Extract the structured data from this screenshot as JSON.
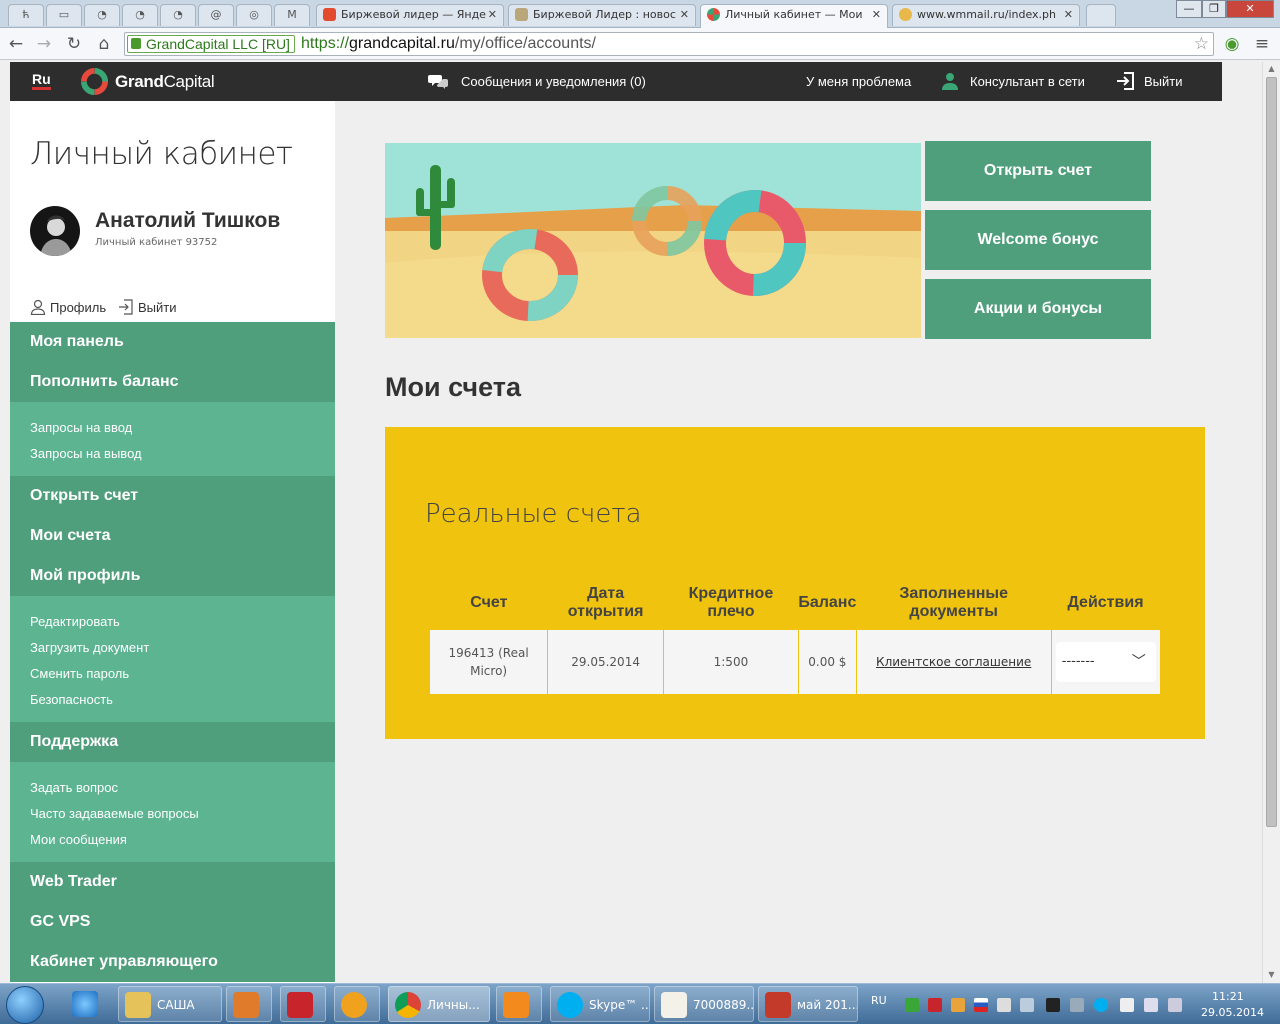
{
  "browser": {
    "tabs": [
      {
        "title": "Биржевой лидер — Янде"
      },
      {
        "title": "Биржевой Лидер : новос"
      },
      {
        "title": "Личный кабинет — Мои"
      },
      {
        "title": "www.wmmail.ru/index.ph"
      }
    ],
    "ev_label": "GrandCapital LLC [RU]",
    "url_scheme": "https://",
    "url_host": "grandcapital.ru",
    "url_path": "/my/office/accounts/"
  },
  "header": {
    "lang": "Ru",
    "logo_bold": "Grand",
    "logo_light": "Capital",
    "messages": "Сообщения и уведомления (0)",
    "problem": "У меня проблема",
    "consultant": "Консультант в сети",
    "logout": "Выйти"
  },
  "sidebar": {
    "title": "Личный кабинет",
    "user_name": "Анатолий Тишков",
    "user_sub": "Личный кабинет 93752",
    "profile_link": "Профиль",
    "logout_link": "Выйти",
    "menu": {
      "my_panel": "Моя панель",
      "deposit": "Пополнить баланс",
      "deposit_requests": "Запросы на ввод",
      "withdraw_requests": "Запросы на вывод",
      "open_account": "Открыть счет",
      "my_accounts": "Мои счета",
      "my_profile": "Мой профиль",
      "edit": "Редактировать",
      "upload_doc": "Загрузить документ",
      "change_password": "Сменить пароль",
      "security": "Безопасность",
      "support": "Поддержка",
      "ask_question": "Задать вопрос",
      "faq": "Часто задаваемые вопросы",
      "my_messages": "Мои сообщения",
      "web_trader": "Web Trader",
      "gc_vps": "GC VPS",
      "manager_cabinet": "Кабинет управляющего"
    }
  },
  "promo": {
    "open_account": "Открыть счет",
    "welcome_bonus": "Welcome бонус",
    "promotions": "Акции и бонусы"
  },
  "accounts": {
    "title": "Мои счета",
    "section_title": "Реальные счета",
    "columns": {
      "account": "Счет",
      "opened_1": "Дата",
      "opened_2": "открытия",
      "leverage_1": "Кредитное",
      "leverage_2": "плечо",
      "balance": "Баланс",
      "docs_1": "Заполненные",
      "docs_2": "документы",
      "actions": "Действия"
    },
    "row": {
      "account_1": "196413 (Real",
      "account_2": "Micro)",
      "opened": "29.05.2014",
      "leverage": "1:500",
      "balance": "0.00 $",
      "document": "Клиентское соглашение",
      "action_value": "-------"
    }
  },
  "taskbar": {
    "sasha": "САША",
    "chrome": "Личны...",
    "skype": "Skype™ ...",
    "alpari": "7000889...",
    "may": "май 201...",
    "lang": "RU",
    "time": "11:21",
    "date": "29.05.2014"
  },
  "colors": {
    "green_dark": "#4f9e7c",
    "green_light": "#5cb491",
    "yellow": "#f0c30f",
    "header_bg": "#2d2d2d"
  }
}
